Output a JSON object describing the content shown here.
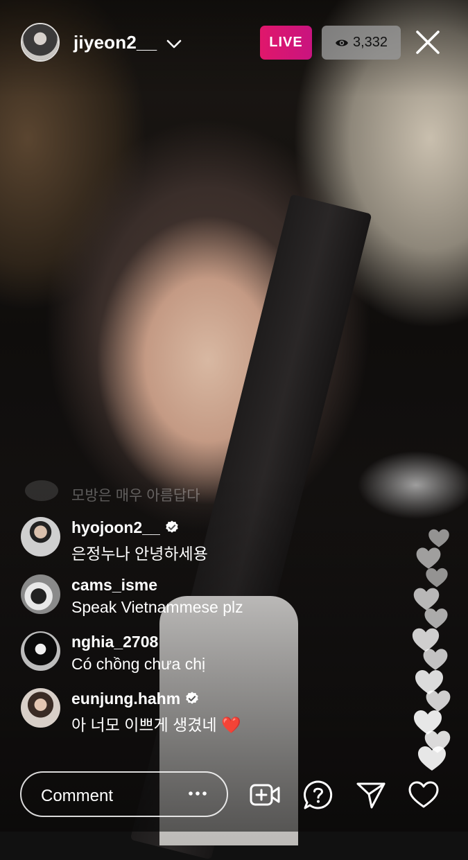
{
  "header": {
    "username": "jiyeon2__",
    "live_label": "LIVE",
    "viewer_count": "3,332"
  },
  "comments": {
    "faded": {
      "text": "모방은 매우 아름답다"
    },
    "items": [
      {
        "username": "hyojoon2__",
        "verified": true,
        "text": "은정누나 안녕하세용"
      },
      {
        "username": "cams_isme",
        "verified": false,
        "text": "Speak Vietnammese plz"
      },
      {
        "username": "nghia_2708",
        "verified": false,
        "text": "Có chồng chưa chị"
      },
      {
        "username": "eunjung.hahm",
        "verified": true,
        "text": "아 너모 이쁘게 생겼네 ❤️"
      }
    ]
  },
  "bottom_bar": {
    "comment_placeholder": "Comment",
    "icons": [
      "add-video-icon",
      "question-icon",
      "send-icon",
      "heart-icon"
    ]
  },
  "colors": {
    "live_badge": "#d3156f",
    "viewer_badge": "#969696",
    "verified": "#ffffff"
  }
}
